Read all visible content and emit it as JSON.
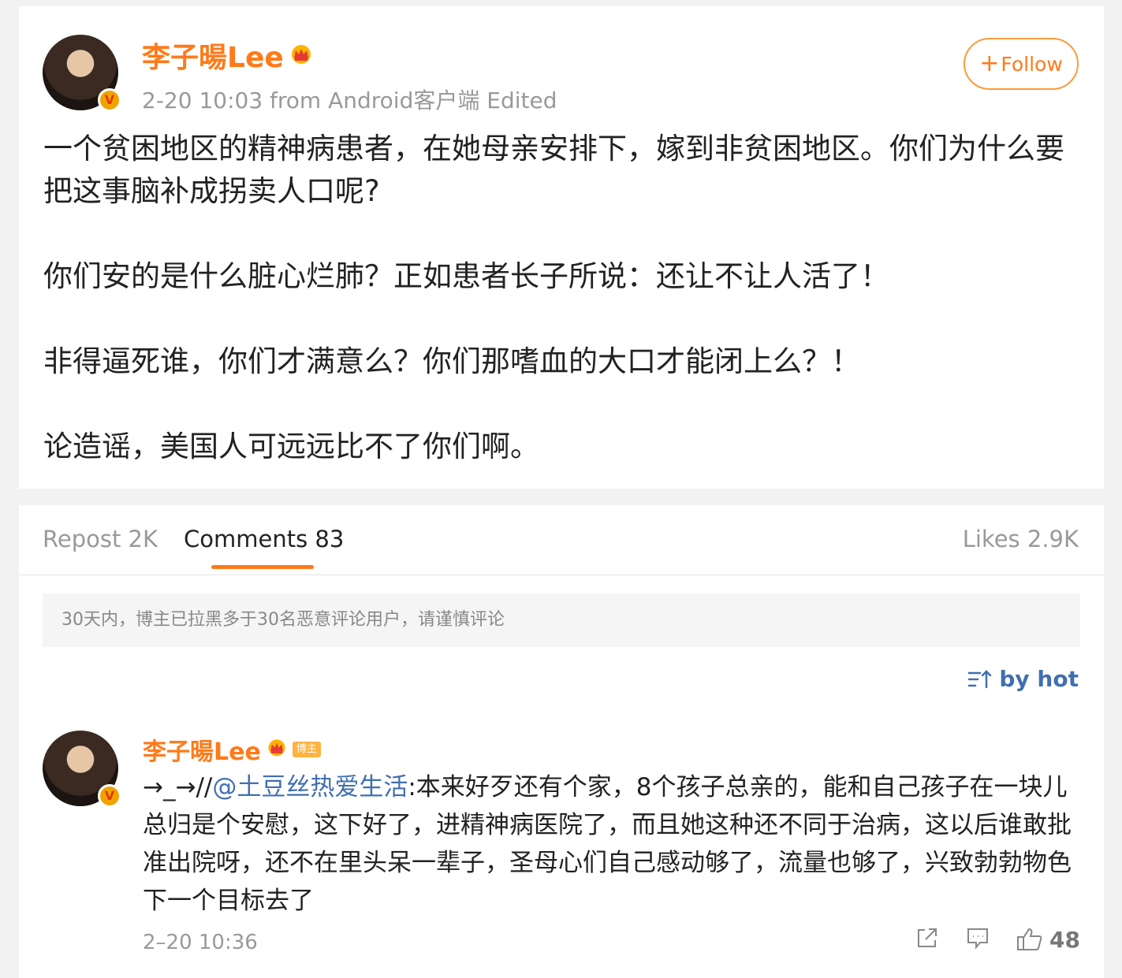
{
  "post": {
    "author": "李子暘Lee",
    "meta": "2-20 10:03  from Android客户端  Edited",
    "follow_label": "Follow",
    "paragraphs": [
      "一个贫困地区的精神病患者，在她母亲安排下，嫁到非贫困地区。你们为什么要把这事脑补成拐卖人口呢?",
      "你们安的是什么脏心烂肺？正如患者长子所说：还让不让人活了！",
      "非得逼死谁，你们才满意么？你们那嗜血的大口才能闭上么？！",
      "论造谣，美国人可远远比不了你们啊。"
    ]
  },
  "tabs": {
    "repost": "Repost 2K",
    "comments": "Comments 83",
    "likes": "Likes 2.9K"
  },
  "notice": "30天内，博主已拉黑多于30名恶意评论用户，请谨慎评论",
  "sort_label": "by hot",
  "comment": {
    "author": "李子暘Lee",
    "host_badge": "博主",
    "prefix": "→_→//",
    "mention": "@土豆丝热爱生活",
    "text": ":本来好歹还有个家，8个孩子总亲的，能和自己孩子在一块儿总归是个安慰，这下好了，进精神病医院了，而且她这种还不同于治病，这以后谁敢批准出院呀，还不在里头呆一辈子，圣母心们自己感动够了，流量也够了，兴致勃勃物色下一个目标去了",
    "date": "2–20 10:36",
    "likes": "48"
  },
  "colors": {
    "accent": "#ff7a18",
    "link": "#3f6fb0"
  }
}
